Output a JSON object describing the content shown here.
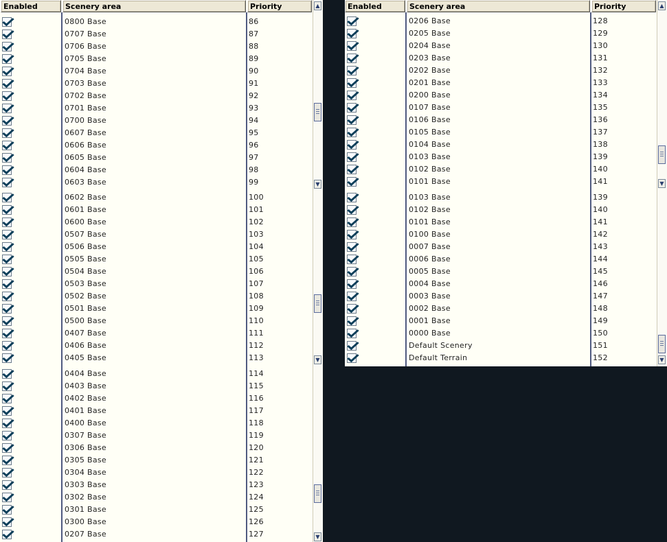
{
  "columns": {
    "enabled": "Enabled",
    "area": "Scenery area",
    "priority": "Priority"
  },
  "left_blocks": [
    {
      "rows": [
        {
          "name": "0800 Base",
          "priority": "86"
        },
        {
          "name": "0707 Base",
          "priority": "87"
        },
        {
          "name": "0706 Base",
          "priority": "88"
        },
        {
          "name": "0705 Base",
          "priority": "89"
        },
        {
          "name": "0704 Base",
          "priority": "90"
        },
        {
          "name": "0703 Base",
          "priority": "91"
        },
        {
          "name": "0702 Base",
          "priority": "92"
        },
        {
          "name": "0701 Base",
          "priority": "93"
        },
        {
          "name": "0700 Base",
          "priority": "94"
        },
        {
          "name": "0607 Base",
          "priority": "95"
        },
        {
          "name": "0606 Base",
          "priority": "96"
        },
        {
          "name": "0605 Base",
          "priority": "97"
        },
        {
          "name": "0604 Base",
          "priority": "98"
        },
        {
          "name": "0603 Base",
          "priority": "99"
        }
      ]
    },
    {
      "rows": [
        {
          "name": "0602 Base",
          "priority": "100"
        },
        {
          "name": "0601 Base",
          "priority": "101"
        },
        {
          "name": "0600 Base",
          "priority": "102"
        },
        {
          "name": "0507 Base",
          "priority": "103"
        },
        {
          "name": "0506 Base",
          "priority": "104"
        },
        {
          "name": "0505 Base",
          "priority": "105"
        },
        {
          "name": "0504 Base",
          "priority": "106"
        },
        {
          "name": "0503 Base",
          "priority": "107"
        },
        {
          "name": "0502 Base",
          "priority": "108"
        },
        {
          "name": "0501 Base",
          "priority": "109"
        },
        {
          "name": "0500 Base",
          "priority": "110"
        },
        {
          "name": "0407 Base",
          "priority": "111"
        },
        {
          "name": "0406 Base",
          "priority": "112"
        },
        {
          "name": "0405 Base",
          "priority": "113"
        }
      ]
    },
    {
      "rows": [
        {
          "name": "0404 Base",
          "priority": "114"
        },
        {
          "name": "0403 Base",
          "priority": "115"
        },
        {
          "name": "0402 Base",
          "priority": "116"
        },
        {
          "name": "0401 Base",
          "priority": "117"
        },
        {
          "name": "0400 Base",
          "priority": "118"
        },
        {
          "name": "0307 Base",
          "priority": "119"
        },
        {
          "name": "0306 Base",
          "priority": "120"
        },
        {
          "name": "0305 Base",
          "priority": "121"
        },
        {
          "name": "0304 Base",
          "priority": "122"
        },
        {
          "name": "0303 Base",
          "priority": "123"
        },
        {
          "name": "0302 Base",
          "priority": "124"
        },
        {
          "name": "0301 Base",
          "priority": "125"
        },
        {
          "name": "0300 Base",
          "priority": "126"
        },
        {
          "name": "0207 Base",
          "priority": "127"
        }
      ]
    }
  ],
  "right_blocks": [
    {
      "rows": [
        {
          "name": "0206 Base",
          "priority": "128"
        },
        {
          "name": "0205 Base",
          "priority": "129"
        },
        {
          "name": "0204 Base",
          "priority": "130"
        },
        {
          "name": "0203 Base",
          "priority": "131"
        },
        {
          "name": "0202 Base",
          "priority": "132"
        },
        {
          "name": "0201 Base",
          "priority": "133"
        },
        {
          "name": "0200 Base",
          "priority": "134"
        },
        {
          "name": "0107 Base",
          "priority": "135"
        },
        {
          "name": "0106 Base",
          "priority": "136"
        },
        {
          "name": "0105 Base",
          "priority": "137"
        },
        {
          "name": "0104 Base",
          "priority": "138"
        },
        {
          "name": "0103 Base",
          "priority": "139"
        },
        {
          "name": "0102 Base",
          "priority": "140"
        },
        {
          "name": "0101 Base",
          "priority": "141"
        }
      ]
    },
    {
      "rows": [
        {
          "name": "0103 Base",
          "priority": "139"
        },
        {
          "name": "0102 Base",
          "priority": "140"
        },
        {
          "name": "0101 Base",
          "priority": "141"
        },
        {
          "name": "0100 Base",
          "priority": "142"
        },
        {
          "name": "0007 Base",
          "priority": "143"
        },
        {
          "name": "0006 Base",
          "priority": "144"
        },
        {
          "name": "0005 Base",
          "priority": "145"
        },
        {
          "name": "0004 Base",
          "priority": "146"
        },
        {
          "name": "0003 Base",
          "priority": "147"
        },
        {
          "name": "0002 Base",
          "priority": "148"
        },
        {
          "name": "0001 Base",
          "priority": "149"
        },
        {
          "name": "0000 Base",
          "priority": "150"
        },
        {
          "name": "Default Scenery",
          "priority": "151"
        },
        {
          "name": "Default Terrain",
          "priority": "152"
        }
      ]
    }
  ],
  "icons": {
    "checkbox": "checkmark-icon",
    "up": "arrow-up-icon",
    "down": "arrow-down-icon"
  },
  "colors": {
    "background": "#101820",
    "list": "#fffff6",
    "header": "#ede8d6",
    "divider": "#505a80"
  }
}
